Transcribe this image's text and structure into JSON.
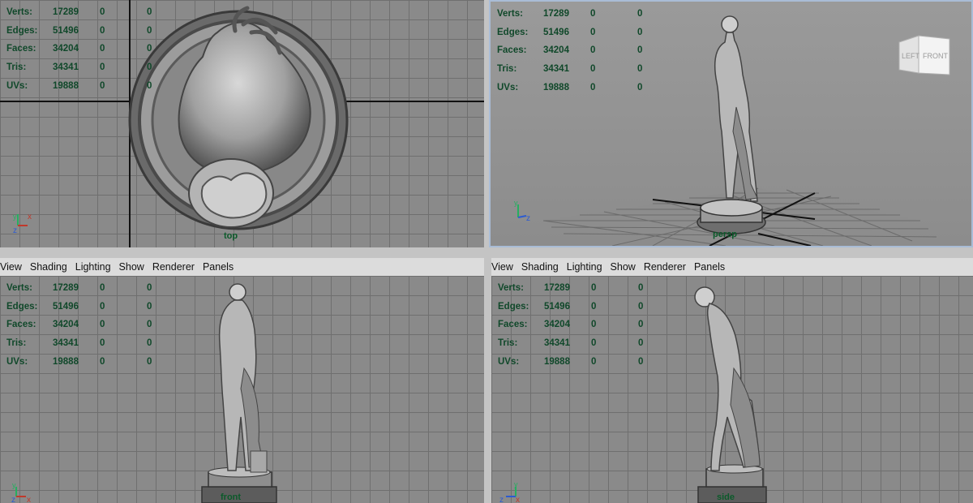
{
  "stats": {
    "rows": [
      {
        "label": "Verts:",
        "value": "17289",
        "col2": "0",
        "col3": "0"
      },
      {
        "label": "Edges:",
        "value": "51496",
        "col2": "0",
        "col3": "0"
      },
      {
        "label": "Faces:",
        "value": "34204",
        "col2": "0",
        "col3": "0"
      },
      {
        "label": "Tris:",
        "value": "34341",
        "col2": "0",
        "col3": "0"
      },
      {
        "label": "UVs:",
        "value": "19888",
        "col2": "0",
        "col3": "0"
      }
    ]
  },
  "menu": {
    "items": [
      "View",
      "Shading",
      "Lighting",
      "Show",
      "Renderer",
      "Panels"
    ]
  },
  "viewports": {
    "top": {
      "camera": "top"
    },
    "persp": {
      "camera": "persp"
    },
    "front": {
      "camera": "front"
    },
    "side": {
      "camera": "side"
    }
  },
  "viewcube": {
    "left": "LEFT",
    "front": "FRONT"
  },
  "axis": {
    "x": "x",
    "y": "y",
    "z": "z"
  },
  "colors": {
    "hud_text": "#10482a",
    "axis_x": "#c0392b",
    "axis_y": "#27ae60",
    "axis_z": "#2c5bd1",
    "grid": "#6f6f6f",
    "viewport_bg": "#8a8a8a",
    "active_border": "#a9bcd6"
  }
}
